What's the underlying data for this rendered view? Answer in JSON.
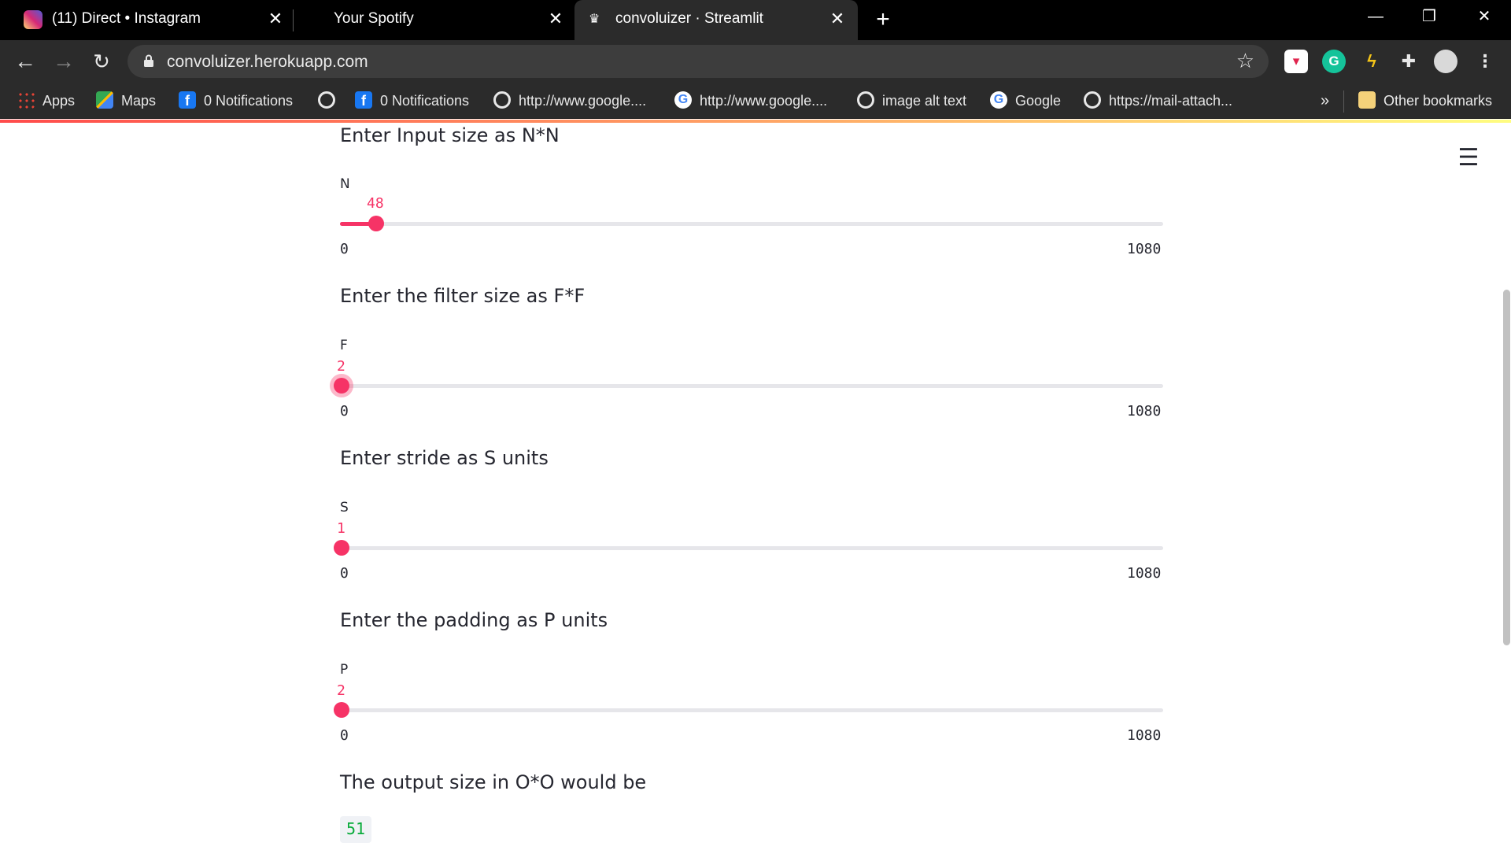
{
  "browser": {
    "tabs": [
      {
        "title": "(11) Direct • Instagram",
        "icon": "instagram-icon"
      },
      {
        "title": "Your Spotify",
        "icon": "none"
      },
      {
        "title": "convoluizer · Streamlit",
        "icon": "streamlit-icon"
      }
    ],
    "url": "convoluizer.herokuapp.com",
    "bookmarks": [
      {
        "label": "Apps",
        "icon": "apps-grid-icon"
      },
      {
        "label": "Maps",
        "icon": "maps-icon"
      },
      {
        "label": "0 Notifications",
        "icon": "facebook-icon"
      },
      {
        "label": "",
        "icon": "globe-icon"
      },
      {
        "label": "0 Notifications",
        "icon": "facebook-icon"
      },
      {
        "label": "http://www.google....",
        "icon": "globe-icon"
      },
      {
        "label": "http://www.google....",
        "icon": "google-icon"
      },
      {
        "label": "image alt text",
        "icon": "globe-icon"
      },
      {
        "label": "Google",
        "icon": "google-icon"
      },
      {
        "label": "https://mail-attach...",
        "icon": "globe-icon"
      }
    ],
    "bookmarks_overflow": "»",
    "other_bookmarks": "Other bookmarks"
  },
  "app": {
    "sliders": [
      {
        "heading": "Enter Input size as N*N",
        "label": "N",
        "value": "48",
        "min": "0",
        "max": "1080",
        "fraction": 0.0444
      },
      {
        "heading": "Enter the filter size as F*F",
        "label": "F",
        "value": "2",
        "min": "0",
        "max": "1080",
        "fraction": 0.00185
      },
      {
        "heading": "Enter stride as S units",
        "label": "S",
        "value": "1",
        "min": "0",
        "max": "1080",
        "fraction": 0.000926
      },
      {
        "heading": "Enter the padding as P units",
        "label": "P",
        "value": "2",
        "min": "0",
        "max": "1080",
        "fraction": 0.00185
      }
    ],
    "output_heading": "The output size in O*O would be",
    "output_value": "51"
  },
  "colors": {
    "accent": "#f63366",
    "output_text": "#09ab3b",
    "tabbar_bg": "#000000",
    "toolbar_bg": "#2b2b2b"
  }
}
